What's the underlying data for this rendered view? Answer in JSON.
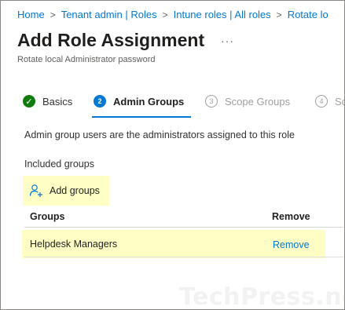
{
  "breadcrumb": {
    "items": [
      "Home",
      "Tenant admin | Roles",
      "Intune roles | All roles",
      "Rotate lo"
    ]
  },
  "header": {
    "title": "Add Role Assignment",
    "more_icon": "ellipsis-icon",
    "subtitle": "Rotate local Administrator password"
  },
  "wizard": {
    "tabs": [
      {
        "step": "✓",
        "label": "Basics",
        "state": "complete"
      },
      {
        "step": "2",
        "label": "Admin Groups",
        "state": "active"
      },
      {
        "step": "3",
        "label": "Scope Groups",
        "state": "disabled"
      },
      {
        "step": "4",
        "label": "Sc",
        "state": "disabled"
      }
    ]
  },
  "main": {
    "description": "Admin group users are the administrators assigned to this role",
    "included_label": "Included groups",
    "add_groups_label": "Add groups",
    "add_groups_icon": "add-user-icon",
    "table": {
      "columns": [
        "Groups",
        "Remove"
      ],
      "rows": [
        {
          "name": "Helpdesk Managers",
          "action": "Remove"
        }
      ]
    }
  },
  "watermark": "TechPress.net",
  "colors": {
    "accent": "#0078d4",
    "success": "#107c10",
    "highlight": "#ffffc5"
  }
}
